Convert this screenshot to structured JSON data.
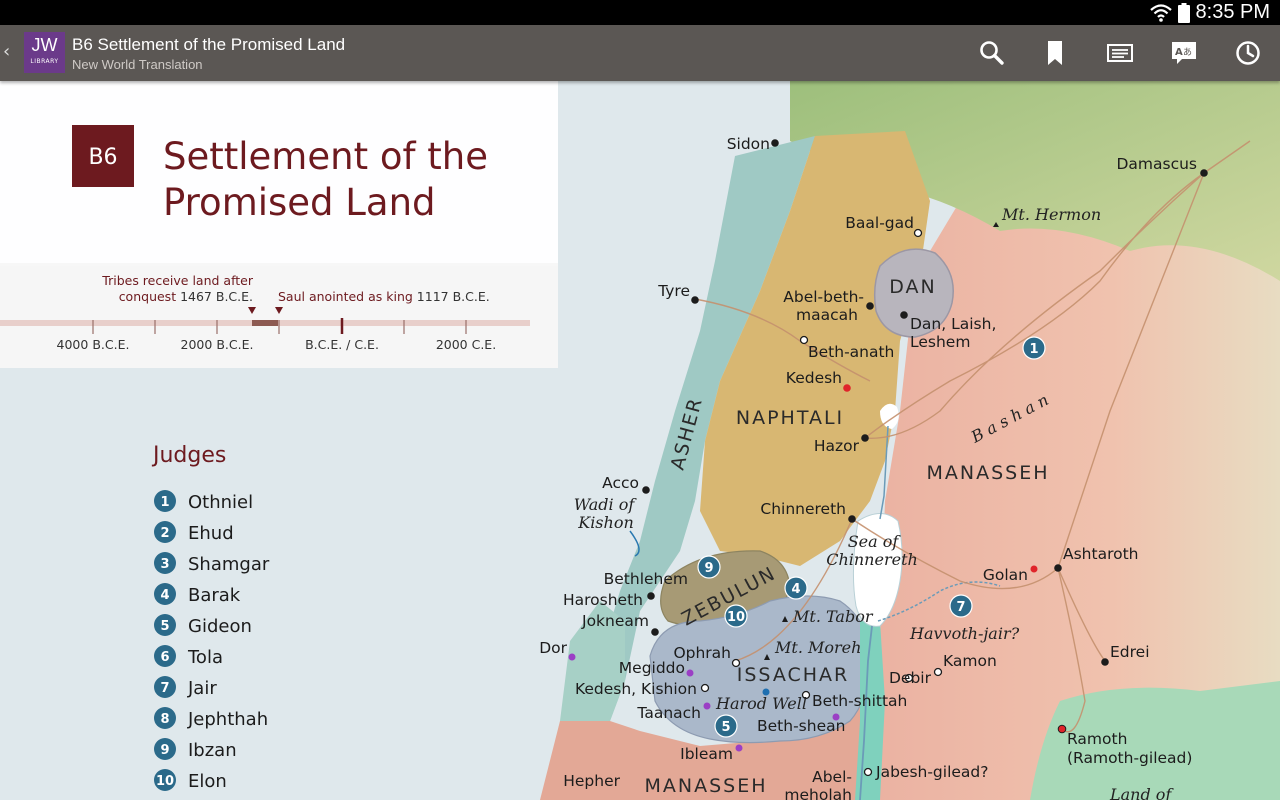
{
  "status_bar": {
    "time": "8:35 PM"
  },
  "action_bar": {
    "logo_top": "JW",
    "logo_bottom": "LIBRARY",
    "title": "B6 Settlement of the Promised Land",
    "subtitle": "New World Translation",
    "icons": [
      "search-icon",
      "bookmark-icon",
      "display-icon",
      "language-icon",
      "history-icon"
    ]
  },
  "panel": {
    "badge": "B6",
    "title_line1": "Settlement of the",
    "title_line2": "Promised Land"
  },
  "timeline": {
    "event1_line1": "Tribes receive land after",
    "event1_line2_text": "conquest",
    "event1_year": "1467 B.C.E.",
    "event2_text": "Saul anointed as king",
    "event2_year": "1117 B.C.E.",
    "years": [
      "4000 B.C.E.",
      "2000 B.C.E.",
      "B.C.E. / C.E.",
      "2000 C.E."
    ]
  },
  "judges": {
    "heading": "Judges",
    "items": [
      {
        "num": "1",
        "name": "Othniel"
      },
      {
        "num": "2",
        "name": "Ehud"
      },
      {
        "num": "3",
        "name": "Shamgar"
      },
      {
        "num": "4",
        "name": "Barak"
      },
      {
        "num": "5",
        "name": "Gideon"
      },
      {
        "num": "6",
        "name": "Tola"
      },
      {
        "num": "7",
        "name": "Jair"
      },
      {
        "num": "8",
        "name": "Jephthah"
      },
      {
        "num": "9",
        "name": "Ibzan"
      },
      {
        "num": "10",
        "name": "Elon"
      }
    ]
  },
  "map": {
    "tribes": {
      "dan": "DAN",
      "naphtali": "NAPHTALI",
      "asher": "ASHER",
      "manasseh_east": "MANASSEH",
      "zebulun": "ZEBULUN",
      "issachar": "ISSACHAR",
      "manasseh_west": "MANASSEH"
    },
    "places": {
      "sidon": "Sidon",
      "damascus": "Damascus",
      "baal_gad": "Baal-gad",
      "mt_hermon": "Mt. Hermon",
      "tyre": "Tyre",
      "abel_beth_maacah_1": "Abel-beth-",
      "abel_beth_maacah_2": "maacah",
      "dan_laish_1": "Dan, Laish,",
      "dan_laish_2": "Leshem",
      "beth_anath": "Beth-anath",
      "kedesh": "Kedesh",
      "bashan": "Bashan",
      "hazor": "Hazor",
      "acco": "Acco",
      "wadi_kishon_1": "Wadi of",
      "wadi_kishon_2": "Kishon",
      "chinnereth": "Chinnereth",
      "sea_chinnereth_1": "Sea of",
      "sea_chinnereth_2": "Chinnereth",
      "ashtaroth": "Ashtaroth",
      "golan": "Golan",
      "bethlehem": "Bethlehem",
      "harosheth": "Harosheth",
      "jokneam": "Jokneam",
      "mt_tabor": "Mt. Tabor",
      "havvoth_jair": "Havvoth-jair?",
      "dor": "Dor",
      "ophrah": "Ophrah",
      "mt_moreh": "Mt. Moreh",
      "megiddo": "Megiddo",
      "kedesh_kishion": "Kedesh, Kishion",
      "harod_well": "Harod Well",
      "debir": "Debir",
      "kamon": "Kamon",
      "edrei": "Edrei",
      "beth_shittah": "Beth-shittah",
      "taanach": "Taanach",
      "beth_shean": "Beth-shean",
      "ibleam": "Ibleam",
      "ramoth_1": "Ramoth",
      "ramoth_2": "(Ramoth-gilead)",
      "hepher": "Hepher",
      "abel_meholah_1": "Abel-",
      "abel_meholah_2": "meholah",
      "jabesh_gilead": "Jabesh-gilead?",
      "land_of": "Land of"
    },
    "markers": [
      "1",
      "9",
      "4",
      "10",
      "7",
      "5"
    ],
    "colors": {
      "sea": "#dfe8ec",
      "asher": "#9fc9c4",
      "naphtali": "#d6b56e",
      "dan": "#b7b4bd",
      "manasseh": "#e7a99a",
      "zebulun": "#a59873",
      "issachar": "#a9b7c9",
      "north": "#a9c48a",
      "marker": "#2b6a8a",
      "title": "#6d1a1f"
    }
  }
}
